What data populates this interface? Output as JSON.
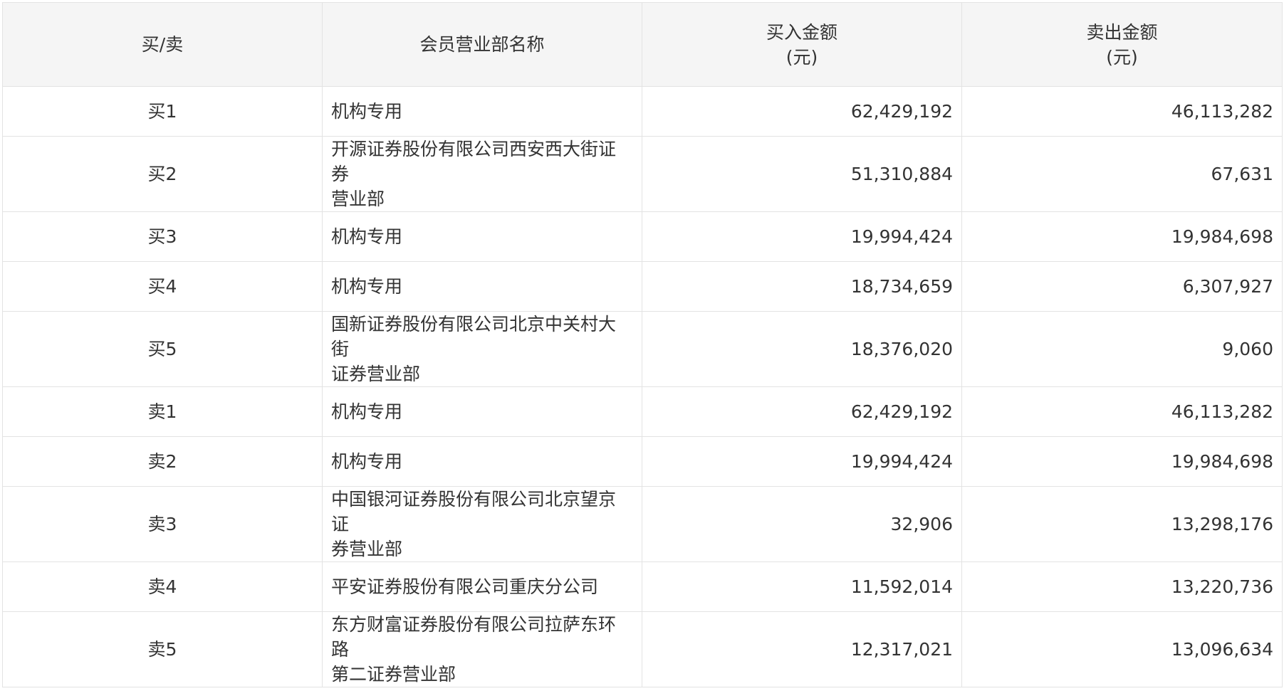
{
  "table": {
    "headers": {
      "side": "买/卖",
      "member": "会员营业部名称",
      "buy_amount": [
        "买入金额",
        "(元)"
      ],
      "sell_amount": [
        "卖出金额",
        "(元)"
      ]
    },
    "rows": [
      {
        "side": "买1",
        "member": [
          "机构专用"
        ],
        "buy": "62,429,192",
        "sell": "46,113,282"
      },
      {
        "side": "买2",
        "member": [
          "开源证券股份有限公司西安西大街证券",
          "营业部"
        ],
        "buy": "51,310,884",
        "sell": "67,631"
      },
      {
        "side": "买3",
        "member": [
          "机构专用"
        ],
        "buy": "19,994,424",
        "sell": "19,984,698"
      },
      {
        "side": "买4",
        "member": [
          "机构专用"
        ],
        "buy": "18,734,659",
        "sell": "6,307,927"
      },
      {
        "side": "买5",
        "member": [
          "国新证券股份有限公司北京中关村大街",
          "证券营业部"
        ],
        "buy": "18,376,020",
        "sell": "9,060"
      },
      {
        "side": "卖1",
        "member": [
          "机构专用"
        ],
        "buy": "62,429,192",
        "sell": "46,113,282"
      },
      {
        "side": "卖2",
        "member": [
          "机构专用"
        ],
        "buy": "19,994,424",
        "sell": "19,984,698"
      },
      {
        "side": "卖3",
        "member": [
          "中国银河证券股份有限公司北京望京证",
          "券营业部"
        ],
        "buy": "32,906",
        "sell": "13,298,176"
      },
      {
        "side": "卖4",
        "member": [
          "平安证券股份有限公司重庆分公司"
        ],
        "buy": "11,592,014",
        "sell": "13,220,736"
      },
      {
        "side": "卖5",
        "member": [
          "东方财富证券股份有限公司拉萨东环路",
          "第二证券营业部"
        ],
        "buy": "12,317,021",
        "sell": "13,096,634"
      }
    ]
  }
}
